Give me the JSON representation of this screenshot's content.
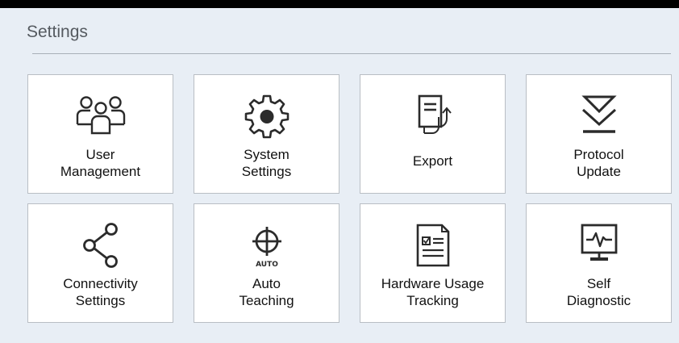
{
  "header": {
    "title": "Settings"
  },
  "tiles": [
    {
      "icon": "users-icon",
      "label_lines": [
        "User",
        "Management"
      ]
    },
    {
      "icon": "gear-icon",
      "label_lines": [
        "System",
        "Settings"
      ]
    },
    {
      "icon": "export-icon",
      "label_lines": [
        "Export"
      ]
    },
    {
      "icon": "download-chevron-icon",
      "label_lines": [
        "Protocol",
        "Update"
      ]
    },
    {
      "icon": "share-icon",
      "label_lines": [
        "Connectivity",
        "Settings"
      ]
    },
    {
      "icon": "crosshair-icon",
      "icon_caption": "AUTO",
      "label_lines": [
        "Auto",
        "Teaching"
      ]
    },
    {
      "icon": "checklist-document-icon",
      "label_lines": [
        "Hardware Usage",
        "Tracking"
      ]
    },
    {
      "icon": "heartbeat-monitor-icon",
      "label_lines": [
        "Self",
        "Diagnostic"
      ]
    }
  ],
  "colors": {
    "background": "#e8eef5",
    "tile_background": "#ffffff",
    "tile_border": "#b9bec4",
    "title_text": "#555a60",
    "icon_stroke": "#2b2b2b"
  }
}
